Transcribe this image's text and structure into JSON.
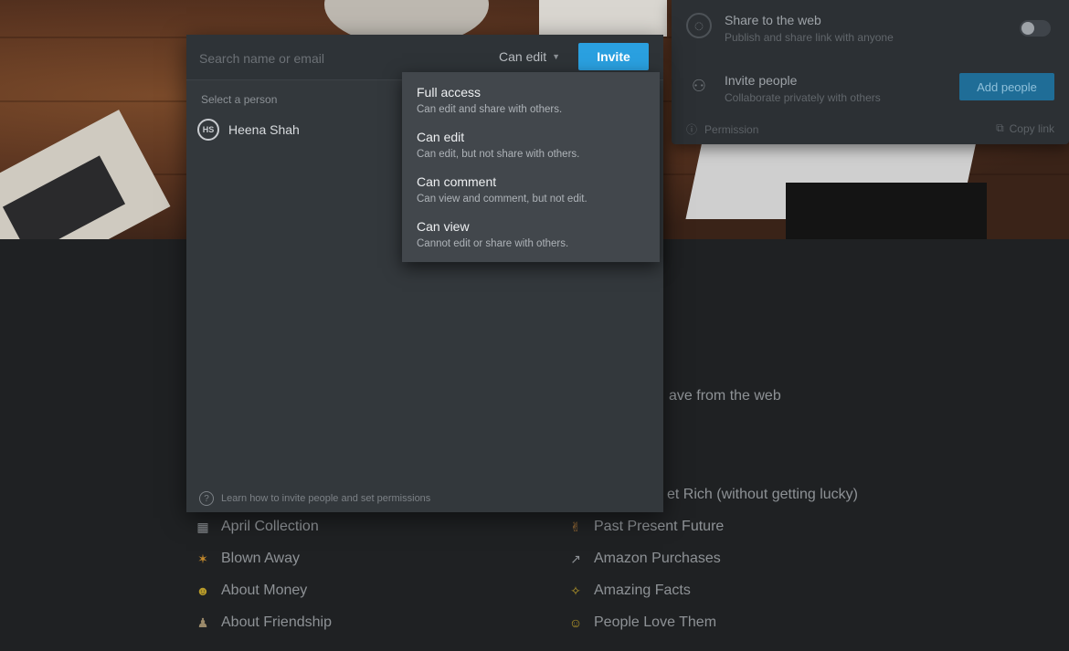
{
  "invite_modal": {
    "search_placeholder": "Search name or email",
    "permission_selected": "Can edit",
    "invite_label": "Invite",
    "select_person_label": "Select a person",
    "people": [
      {
        "initials": "HS",
        "name": "Heena Shah"
      }
    ],
    "footer_help": "Learn how to invite people and set permissions"
  },
  "permission_menu": {
    "options": [
      {
        "title": "Full access",
        "description": "Can edit and share with others."
      },
      {
        "title": "Can edit",
        "description": "Can edit, but not share with others."
      },
      {
        "title": "Can comment",
        "description": "Can view and comment, but not edit."
      },
      {
        "title": "Can view",
        "description": "Cannot edit or share with others."
      }
    ]
  },
  "share_panel": {
    "share_web_title": "Share to the web",
    "share_web_sub": "Publish and share link with anyone",
    "invite_title": "Invite people",
    "invite_sub": "Collaborate privately with others",
    "add_people_label": "Add people",
    "footer_left": "Permission",
    "footer_right": "Copy link"
  },
  "background": {
    "partial_text_1": "ave from the web",
    "partial_text_2": "et Rich (without getting lucky)",
    "left_items": [
      "April Collection",
      "Blown Away",
      "About Money",
      "About Friendship"
    ],
    "right_items": [
      "Past Present Future",
      "Amazon Purchases",
      "Amazing Facts",
      "People Love Them"
    ]
  },
  "colors": {
    "accent": "#2aa0e0",
    "modal_bg": "#33383c",
    "menu_bg": "#42474c",
    "page_bg": "#1f2123"
  }
}
